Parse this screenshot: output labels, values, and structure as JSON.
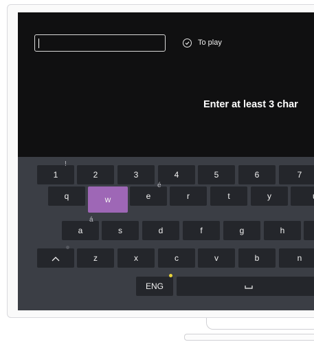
{
  "search": {
    "value": ""
  },
  "status": {
    "icon": "check-circle-icon",
    "label": "To play"
  },
  "message": "Enter at least 3 char",
  "keyboard": {
    "rows": [
      [
        {
          "name": "key-1",
          "label": "1",
          "alt": "!"
        },
        {
          "name": "key-2",
          "label": "2"
        },
        {
          "name": "key-3",
          "label": "3"
        },
        {
          "name": "key-4",
          "label": "4"
        },
        {
          "name": "key-5",
          "label": "5"
        },
        {
          "name": "key-6",
          "label": "6"
        },
        {
          "name": "key-7",
          "label": "7"
        }
      ],
      [
        {
          "name": "key-q",
          "label": "q"
        },
        {
          "name": "key-w",
          "label": "w",
          "active": true
        },
        {
          "name": "key-e",
          "label": "e",
          "alt": "é"
        },
        {
          "name": "key-r",
          "label": "r"
        },
        {
          "name": "key-t",
          "label": "t"
        },
        {
          "name": "key-y",
          "label": "y"
        },
        {
          "name": "key-u",
          "label": "u"
        }
      ],
      [
        {
          "name": "key-a",
          "label": "a",
          "alt": "á"
        },
        {
          "name": "key-s",
          "label": "s"
        },
        {
          "name": "key-d",
          "label": "d"
        },
        {
          "name": "key-f",
          "label": "f"
        },
        {
          "name": "key-g",
          "label": "g"
        },
        {
          "name": "key-h",
          "label": "h"
        },
        {
          "name": "key-j",
          "label": ""
        }
      ],
      [
        {
          "name": "shift-key",
          "label": "^",
          "icon": "caret-up-icon"
        },
        {
          "name": "key-z",
          "label": "z"
        },
        {
          "name": "key-x",
          "label": "x"
        },
        {
          "name": "key-c",
          "label": "c"
        },
        {
          "name": "key-v",
          "label": "v"
        },
        {
          "name": "key-b",
          "label": "b"
        },
        {
          "name": "key-n",
          "label": "n"
        }
      ],
      [
        {
          "name": "language-key",
          "label": "ENG"
        },
        {
          "name": "space-key",
          "label": "␣",
          "icon": "space-bar-icon"
        }
      ]
    ]
  },
  "colors": {
    "screen": "#101011",
    "keyboard": "#3b3e45",
    "key": "#24262b",
    "highlight": "#9e67b6",
    "language_dot": "#e8d33a"
  }
}
